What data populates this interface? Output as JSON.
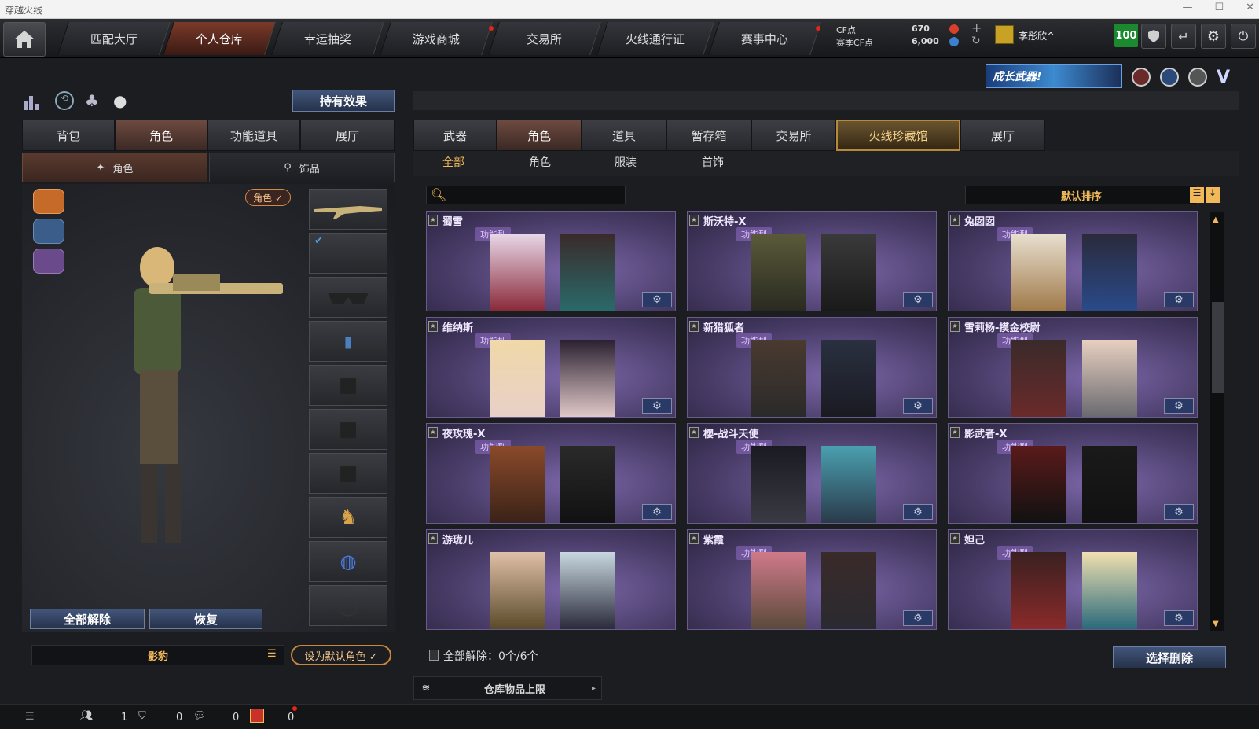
{
  "window": {
    "title": "穿越火线"
  },
  "topnav": {
    "tabs": [
      {
        "label": "匹配大厅"
      },
      {
        "label": "个人仓库"
      },
      {
        "label": "幸运抽奖"
      },
      {
        "label": "游戏商城"
      },
      {
        "label": "交易所"
      },
      {
        "label": "火线通行证"
      },
      {
        "label": "赛事中心"
      }
    ],
    "cf_label": "CF点",
    "cf_value": "670",
    "season_cf_label": "赛季CF点",
    "season_cf_value": "6,000",
    "username": "李彤欣^",
    "badge": "100"
  },
  "banner": {
    "text": "成长武器!"
  },
  "left": {
    "effects_button": "持有效果",
    "tabs": [
      {
        "label": "背包"
      },
      {
        "label": "角色"
      },
      {
        "label": "功能道具"
      },
      {
        "label": "展厅"
      }
    ],
    "subtabs": [
      {
        "label": "角色"
      },
      {
        "label": "饰品"
      }
    ],
    "role_tag": "角色 ✓",
    "release_all": "全部解除",
    "restore": "恢复",
    "char_name": "影豹",
    "set_default": "设为默认角色 ✓"
  },
  "right": {
    "tabs": [
      {
        "label": "武器"
      },
      {
        "label": "角色"
      },
      {
        "label": "道具"
      },
      {
        "label": "暂存箱"
      },
      {
        "label": "交易所"
      },
      {
        "label": "火线珍藏馆"
      },
      {
        "label": "展厅"
      }
    ],
    "subtabs": [
      {
        "label": "全部"
      },
      {
        "label": "角色"
      },
      {
        "label": "服装"
      },
      {
        "label": "首饰"
      }
    ],
    "sort_label": "默认排序",
    "cards": [
      {
        "name": "蜀雪",
        "type": "功能型"
      },
      {
        "name": "斯沃特-X",
        "type": "功能型"
      },
      {
        "name": "兔囡囡",
        "type": "功能型"
      },
      {
        "name": "维纳斯",
        "type": "功能型"
      },
      {
        "name": "新猎狐者",
        "type": "功能型"
      },
      {
        "name": "雪莉杨-摸金校尉",
        "type": "功能型"
      },
      {
        "name": "夜玫瑰-X",
        "type": "功能型"
      },
      {
        "name": "樱-战斗天使",
        "type": "功能型"
      },
      {
        "name": "影武者-X",
        "type": "功能型"
      },
      {
        "name": "游珑儿",
        "type": ""
      },
      {
        "name": "紫霞",
        "type": "功能型"
      },
      {
        "name": "妲己",
        "type": "功能型"
      }
    ],
    "release_text": "全部解除：0个/6个",
    "select_delete": "选择删除",
    "capacity": "仓库物品上限"
  },
  "status": {
    "v1": "1",
    "v2": "0",
    "v3": "0",
    "v4": "0"
  },
  "colors": {
    "accent": "#f2b95b",
    "active_tab": "#6d4a40",
    "card_bg": "#5a4a80"
  }
}
